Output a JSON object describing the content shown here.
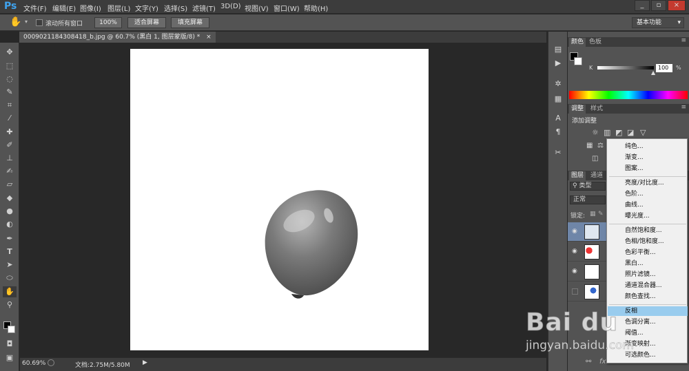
{
  "app": {
    "logo": "Ps"
  },
  "menu": [
    "文件(F)",
    "编辑(E)",
    "图像(I)",
    "图层(L)",
    "文字(Y)",
    "选择(S)",
    "滤镜(T)",
    "3D(D)",
    "视图(V)",
    "窗口(W)",
    "帮助(H)"
  ],
  "window_controls": [
    "_",
    "▫",
    "×"
  ],
  "options": {
    "scroll_all_label": "滚动所有窗口",
    "zoom_100": "100%",
    "fit_screen": "适合屏幕",
    "fill_screen": "填充屏幕",
    "workspace": "基本功能"
  },
  "document": {
    "tab_title": "0009021184308418_b.jpg @ 60.7% (黑白 1, 图层蒙版/8) *",
    "tab_close": "×"
  },
  "status": {
    "zoom": "60.69%",
    "doc_info": "文档:2.75M/5.80M"
  },
  "panels": {
    "color": {
      "tabs": [
        "颜色",
        "色板"
      ],
      "channel_label": "K",
      "value": "100",
      "unit": "%",
      "slider_level": 1.0
    },
    "adjust": {
      "tabs": [
        "调整",
        "样式"
      ],
      "title": "添加调整"
    },
    "layers": {
      "tabs": [
        "图层",
        "通道"
      ],
      "filter_label": "类型",
      "blend_mode": "正常",
      "lock_label": "锁定:"
    }
  },
  "dropdown_menu": {
    "items": [
      {
        "label": "纯色...",
        "highlight": false
      },
      {
        "label": "渐变...",
        "highlight": false
      },
      {
        "label": "图案...",
        "highlight": false
      },
      {
        "sep": true
      },
      {
        "label": "亮度/对比度...",
        "highlight": false
      },
      {
        "label": "色阶...",
        "highlight": false
      },
      {
        "label": "曲线...",
        "highlight": false
      },
      {
        "label": "曝光度...",
        "highlight": false
      },
      {
        "sep": true
      },
      {
        "label": "自然饱和度...",
        "highlight": false
      },
      {
        "label": "色相/饱和度...",
        "highlight": false
      },
      {
        "label": "色彩平衡...",
        "highlight": false
      },
      {
        "label": "黑白...",
        "highlight": false
      },
      {
        "label": "照片滤镜...",
        "highlight": false
      },
      {
        "label": "通道混合器...",
        "highlight": false
      },
      {
        "label": "颜色查找...",
        "highlight": false
      },
      {
        "sep": true
      },
      {
        "label": "反相",
        "highlight": true
      },
      {
        "label": "色调分离...",
        "highlight": false
      },
      {
        "label": "阈值...",
        "highlight": false
      },
      {
        "label": "渐变映射...",
        "highlight": false
      },
      {
        "label": "可选颜色...",
        "highlight": false
      }
    ]
  },
  "watermark": {
    "brand": "Bai du",
    "url": "jingyan.baidu.com"
  },
  "colors": {
    "menubar": "#3c3c3c",
    "panel": "#535353",
    "highlight": "#99ccee",
    "accent": "#3fa4f0"
  }
}
